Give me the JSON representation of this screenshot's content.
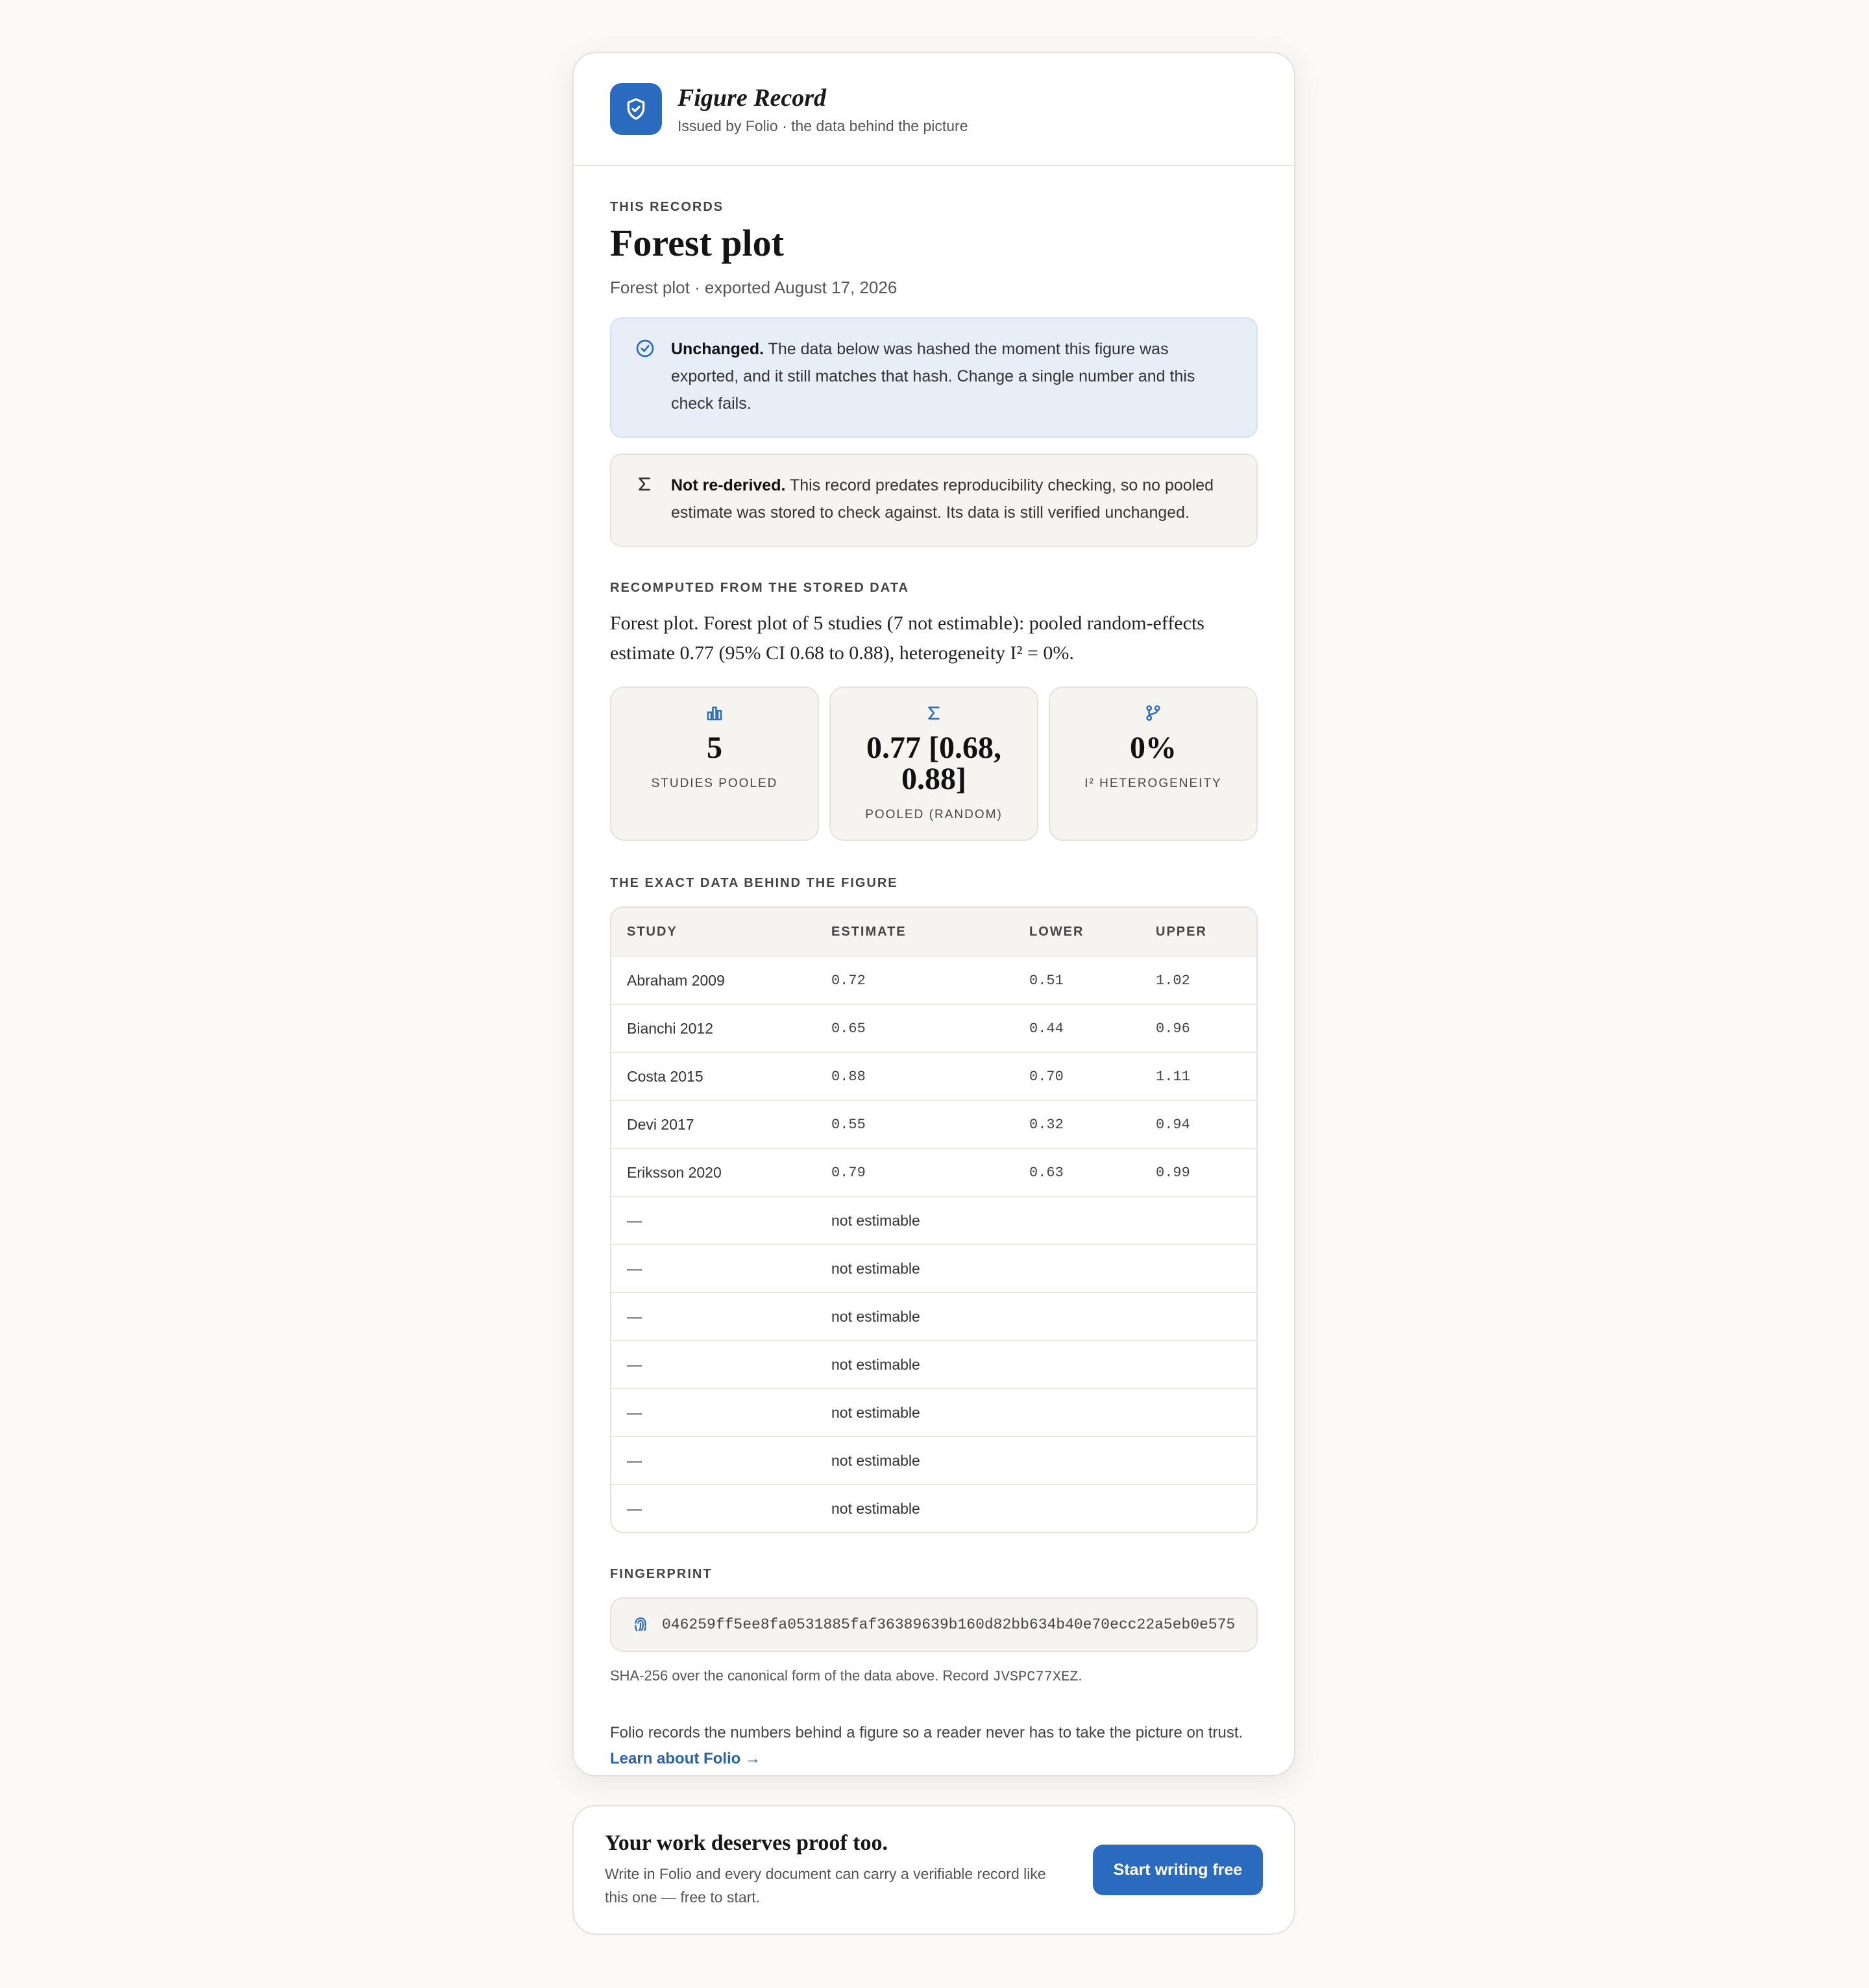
{
  "header": {
    "title": "Figure Record",
    "subtitle": "Issued by Folio · the data behind the picture",
    "logo_icon": "shield-check-icon"
  },
  "record": {
    "eyebrow": "THIS RECORDS",
    "title": "Forest plot",
    "meta": "Forest plot · exported August 17, 2026"
  },
  "alerts": {
    "unchanged": {
      "icon": "check-circle-icon",
      "lead": "Unchanged.",
      "text": " The data below was hashed the moment this figure was exported, and it still matches that hash. Change a single number and this check fails."
    },
    "not_rederived": {
      "icon": "sigma-icon",
      "lead": "Not re-derived.",
      "text": " This record predates reproducibility checking, so no pooled estimate was stored to check against. Its data is still verified unchanged."
    }
  },
  "recomputed": {
    "eyebrow": "RECOMPUTED FROM THE STORED DATA",
    "summary": "Forest plot. Forest plot of 5 studies (7 not estimable): pooled random-effects estimate 0.77 (95% CI 0.68 to 0.88), heterogeneity I² = 0%.",
    "stats": [
      {
        "icon": "bar-chart-icon",
        "value": "5",
        "label": "STUDIES POOLED"
      },
      {
        "icon": "sigma-icon",
        "value": "0.77 [0.68, 0.88]",
        "label": "POOLED (RANDOM)"
      },
      {
        "icon": "branch-icon",
        "value": "0%",
        "label": "I² HETEROGENEITY"
      }
    ]
  },
  "table": {
    "eyebrow": "THE EXACT DATA BEHIND THE FIGURE",
    "columns": [
      "STUDY",
      "ESTIMATE",
      "LOWER",
      "UPPER"
    ],
    "rows": [
      [
        "Abraham 2009",
        "0.72",
        "0.51",
        "1.02"
      ],
      [
        "Bianchi 2012",
        "0.65",
        "0.44",
        "0.96"
      ],
      [
        "Costa 2015",
        "0.88",
        "0.70",
        "1.11"
      ],
      [
        "Devi 2017",
        "0.55",
        "0.32",
        "0.94"
      ],
      [
        "Eriksson 2020",
        "0.79",
        "0.63",
        "0.99"
      ],
      [
        "—",
        "not estimable",
        "",
        ""
      ],
      [
        "—",
        "not estimable",
        "",
        ""
      ],
      [
        "—",
        "not estimable",
        "",
        ""
      ],
      [
        "—",
        "not estimable",
        "",
        ""
      ],
      [
        "—",
        "not estimable",
        "",
        ""
      ],
      [
        "—",
        "not estimable",
        "",
        ""
      ],
      [
        "—",
        "not estimable",
        "",
        ""
      ]
    ]
  },
  "fingerprint": {
    "eyebrow": "FINGERPRINT",
    "icon": "fingerprint-icon",
    "hash": "046259ff5ee8fa0531885faf36389639b160d82bb634b40e70ecc22a5eb0e575",
    "note_prefix": "SHA-256 over the canonical form of the data above. Record ",
    "record_id": "JVSPC77XEZ",
    "note_suffix": "."
  },
  "footer": {
    "text": "Folio records the numbers behind a figure so a reader never has to take the picture on trust.",
    "link_label": "Learn about Folio →"
  },
  "cta": {
    "title": "Your work deserves proof too.",
    "subtitle": "Write in Folio and every document can carry a verifiable record like this one — free to start.",
    "button_label": "Start writing free"
  },
  "colors": {
    "accent": "#2a6bbf",
    "ok_bg": "#e7eef8",
    "note_bg": "#f6f4ef",
    "page_bg": "#faf9f6"
  }
}
